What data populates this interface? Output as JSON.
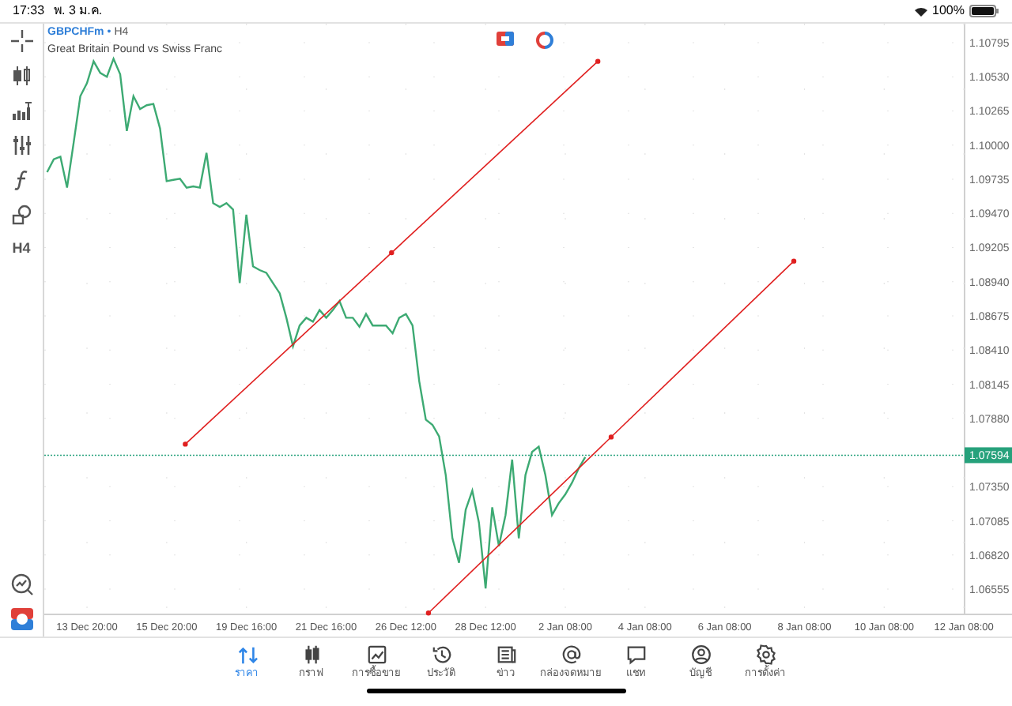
{
  "status_bar": {
    "time": "17:33",
    "date": "พ. 3 ม.ค.",
    "battery": "100%"
  },
  "chart_header": {
    "symbol": "GBPCHFm",
    "separator": "•",
    "timeframe": "H4",
    "description": "Great Britain Pound vs Swiss Franc"
  },
  "left_toolbar": {
    "timeframe_label": "H4"
  },
  "chart": {
    "chart_data": {
      "type": "line",
      "grid": true,
      "ylim": [
        1.06359,
        1.10942
      ],
      "categories": [
        null,
        null,
        null,
        null,
        null,
        null,
        "13 Dec 20:00",
        null,
        null,
        null,
        null,
        null,
        null,
        null,
        null,
        null,
        null,
        null,
        "15 Dec 20:00",
        null,
        null,
        null,
        null,
        null,
        null,
        null,
        null,
        null,
        null,
        null,
        "19 Dec 16:00",
        null,
        null,
        null,
        null,
        null,
        null,
        null,
        null,
        null,
        null,
        null,
        "21 Dec 16:00",
        null,
        null,
        null,
        null,
        null,
        null,
        null,
        null,
        null,
        null,
        null,
        "26 Dec 12:00",
        null,
        null,
        null,
        null,
        null,
        null,
        null,
        null,
        null,
        null,
        null,
        "28 Dec 12:00",
        null,
        null,
        null,
        null,
        null,
        null,
        null,
        null,
        null,
        null,
        null,
        "2 Jan 08:00",
        null,
        null,
        null,
        null,
        null,
        null,
        null,
        null,
        null,
        null,
        null,
        "4 Jan 08:00",
        null,
        null,
        null,
        null,
        null,
        null,
        null,
        null,
        null,
        null,
        null,
        "6 Jan 08:00",
        null,
        null,
        null,
        null,
        null,
        null,
        null,
        null,
        null,
        null,
        null,
        "8 Jan 08:00",
        null,
        null,
        null,
        null,
        null,
        null,
        null,
        null,
        null,
        null,
        null,
        "10 Jan 08:00",
        null,
        null,
        null,
        null,
        null,
        null,
        null,
        null,
        null,
        null,
        null,
        "12 Jan 08:00"
      ],
      "series": [
        {
          "color": "#3daa73",
          "values": [
            1.0979,
            1.0989,
            1.0991,
            1.0967,
            1.1002,
            1.1038,
            1.1048,
            1.1065,
            1.1056,
            1.1053,
            1.1067,
            1.1055,
            1.1011,
            1.1038,
            1.1028,
            1.1031,
            1.1032,
            1.1013,
            1.0972,
            1.0973,
            1.0974,
            1.0967,
            1.0968,
            1.0967,
            1.0994,
            1.0955,
            1.0952,
            1.0955,
            1.095,
            1.0893,
            1.0946,
            1.0906,
            1.0903,
            1.0901,
            1.0893,
            1.0885,
            1.0866,
            1.0844,
            1.086,
            1.0866,
            1.0863,
            1.0872,
            1.0866,
            1.0872,
            1.0879,
            1.0866,
            1.0866,
            1.0859,
            1.0869,
            1.086,
            1.086,
            1.086,
            1.0854,
            1.0866,
            1.0869,
            1.086,
            1.0817,
            1.0787,
            1.0783,
            1.0774,
            1.0744,
            1.0695,
            1.0676,
            1.0717,
            1.0732,
            1.0707,
            1.0656,
            1.0719,
            1.0689,
            1.0713,
            1.0756,
            1.0695,
            1.0744,
            1.0762,
            1.0766,
            1.0744,
            1.0713,
            1.0722,
            1.0729,
            1.0738,
            1.0749,
            1.0758,
            null,
            null,
            null,
            null,
            null,
            null,
            null,
            null,
            null,
            null,
            null,
            null,
            null,
            null,
            null,
            null,
            null,
            null,
            null,
            null,
            null,
            null,
            null,
            null,
            null,
            null,
            null,
            null,
            null,
            null,
            null,
            null,
            null,
            null,
            null,
            null,
            null,
            null,
            null,
            null,
            null,
            null,
            null,
            null,
            null,
            null,
            null,
            null,
            null,
            null,
            null,
            null,
            null,
            null,
            null,
            null,
            null
          ]
        }
      ],
      "yticks": [
        {
          "value": 1.10795,
          "label": "1.10795"
        },
        {
          "value": 1.1053,
          "label": "1.10530"
        },
        {
          "value": 1.10265,
          "label": "1.10265"
        },
        {
          "value": 1.1,
          "label": "1.10000"
        },
        {
          "value": 1.09735,
          "label": "1.09735"
        },
        {
          "value": 1.0947,
          "label": "1.09470"
        },
        {
          "value": 1.09205,
          "label": "1.09205"
        },
        {
          "value": 1.0894,
          "label": "1.08940"
        },
        {
          "value": 1.08675,
          "label": "1.08675"
        },
        {
          "value": 1.0841,
          "label": "1.08410"
        },
        {
          "value": 1.08145,
          "label": "1.08145"
        },
        {
          "value": 1.0788,
          "label": "1.07880"
        },
        {
          "value": 1.0735,
          "label": "1.07350"
        },
        {
          "value": 1.07085,
          "label": "1.07085"
        },
        {
          "value": 1.0682,
          "label": "1.06820"
        },
        {
          "value": 1.06555,
          "label": "1.06555"
        }
      ],
      "ref_lines": [
        {
          "axis": "y",
          "value": 1.07594,
          "label": "1.07594",
          "color": "#26a17b"
        }
      ]
    }
  },
  "tab_bar": [
    {
      "label": "ราคา",
      "selected": true
    },
    {
      "label": "กราฟ",
      "selected": false
    },
    {
      "label": "การซื้อขาย",
      "selected": false
    },
    {
      "label": "ประวัติ",
      "selected": false
    },
    {
      "label": "ข่าว",
      "selected": false
    },
    {
      "label": "กล่องจดหมาย",
      "selected": false
    },
    {
      "label": "แชท",
      "selected": false
    },
    {
      "label": "บัญชี",
      "selected": false
    },
    {
      "label": "การตั้งค่า",
      "selected": false
    }
  ]
}
